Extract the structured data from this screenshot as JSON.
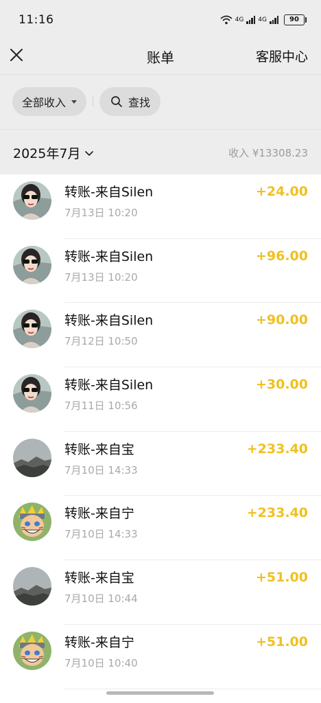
{
  "status_bar": {
    "time": "11:16",
    "network_1": "4G",
    "network_2": "4G",
    "battery": "90"
  },
  "nav": {
    "title": "账单",
    "service": "客服中心",
    "close_icon": "close-icon"
  },
  "filters": {
    "all_income": "全部收入",
    "search": "查找"
  },
  "summary": {
    "month": "2025年7月",
    "income": "收入 ¥13308.23"
  },
  "transactions": [
    {
      "title": "转账-来自Silen",
      "time": "7月13日 10:20",
      "amount": "+24.00",
      "avatar": "girl-sunglasses"
    },
    {
      "title": "转账-来自Silen",
      "time": "7月13日 10:20",
      "amount": "+96.00",
      "avatar": "girl-sunglasses"
    },
    {
      "title": "转账-来自Silen",
      "time": "7月12日 10:50",
      "amount": "+90.00",
      "avatar": "girl-sunglasses"
    },
    {
      "title": "转账-来自Silen",
      "time": "7月11日 10:56",
      "amount": "+30.00",
      "avatar": "girl-sunglasses"
    },
    {
      "title": "转账-来自宝",
      "time": "7月10日 14:33",
      "amount": "+233.40",
      "avatar": "mountain"
    },
    {
      "title": "转账-来自宁",
      "time": "7月10日 14:33",
      "amount": "+233.40",
      "avatar": "anime-boy"
    },
    {
      "title": "转账-来自宝",
      "time": "7月10日 10:44",
      "amount": "+51.00",
      "avatar": "mountain"
    },
    {
      "title": "转账-来自宁",
      "time": "7月10日 10:40",
      "amount": "+51.00",
      "avatar": "anime-boy"
    }
  ],
  "colors": {
    "amount": "#f0c020",
    "background": "#ededed"
  }
}
